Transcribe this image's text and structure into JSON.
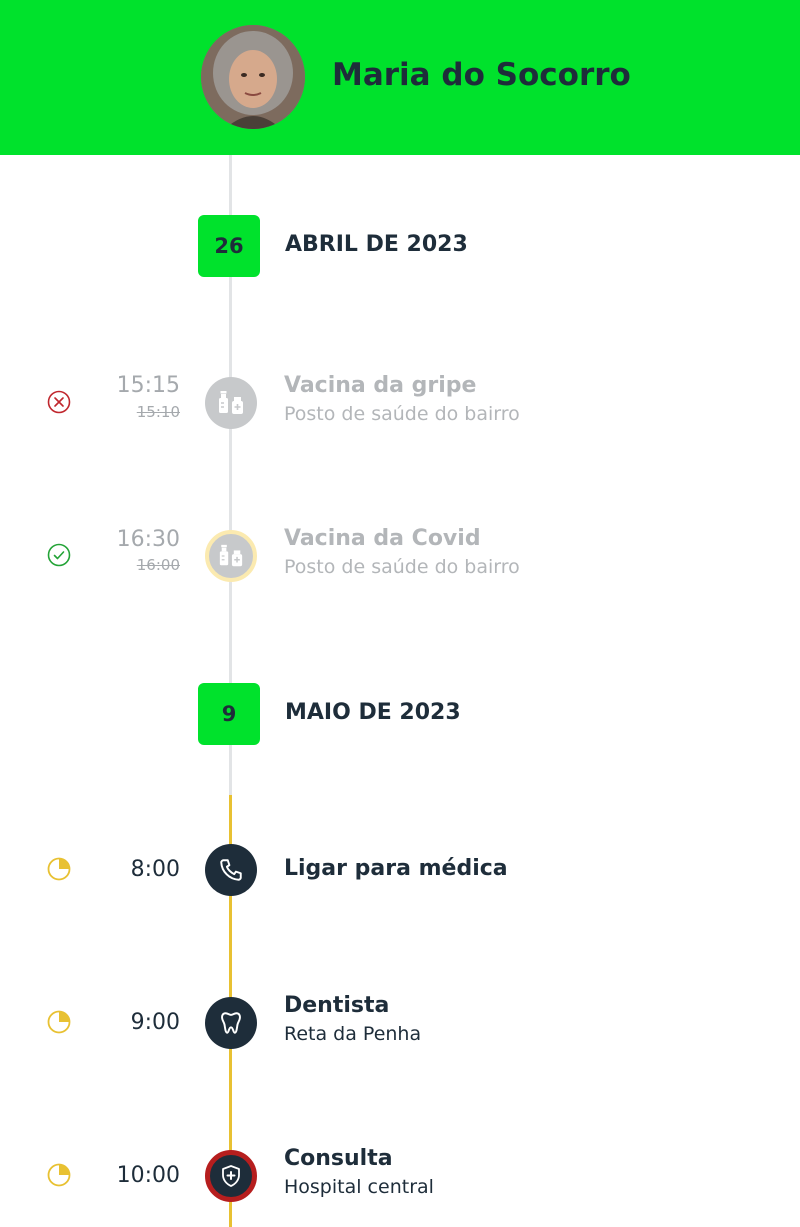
{
  "header": {
    "user_name": "Maria do Socorro"
  },
  "groups": [
    {
      "day": "26",
      "month_label": "ABRIL DE 2023",
      "events": [
        {
          "status": "cancelled",
          "status_icon": "x-circle-icon",
          "time": "15:15",
          "original_time": "15:10",
          "icon": "vaccine-icon",
          "title": "Vacina da gripe",
          "subtitle": "Posto de saúde do bairro"
        },
        {
          "status": "done",
          "status_icon": "check-circle-icon",
          "time": "16:30",
          "original_time": "16:00",
          "icon": "vaccine-icon",
          "title": "Vacina da Covid",
          "subtitle": "Posto de saúde do bairro"
        }
      ]
    },
    {
      "day": "9",
      "month_label": "MAIO DE 2023",
      "events": [
        {
          "status": "pending",
          "status_icon": "clock-quarter-icon",
          "time": "8:00",
          "icon": "phone-icon",
          "title": "Ligar para médica",
          "subtitle": ""
        },
        {
          "status": "pending",
          "status_icon": "clock-quarter-icon",
          "time": "9:00",
          "icon": "tooth-icon",
          "title": "Dentista",
          "subtitle": "Reta da Penha"
        },
        {
          "status": "pending",
          "status_icon": "clock-quarter-icon",
          "time": "10:00",
          "icon": "shield-plus-icon",
          "title": "Consulta",
          "subtitle": "Hospital central"
        }
      ]
    }
  ],
  "colors": {
    "brand_green": "#00e22c",
    "text_dark": "#1e2d3a",
    "muted_gray": "#b3b6b9",
    "rail_gray": "#e2e4e6",
    "rail_yellow": "#e8c132",
    "cancel_red": "#c0262d",
    "done_green": "#23a336",
    "pending_yellow": "#e8c132",
    "urgent_ring": "#b61e1e"
  }
}
